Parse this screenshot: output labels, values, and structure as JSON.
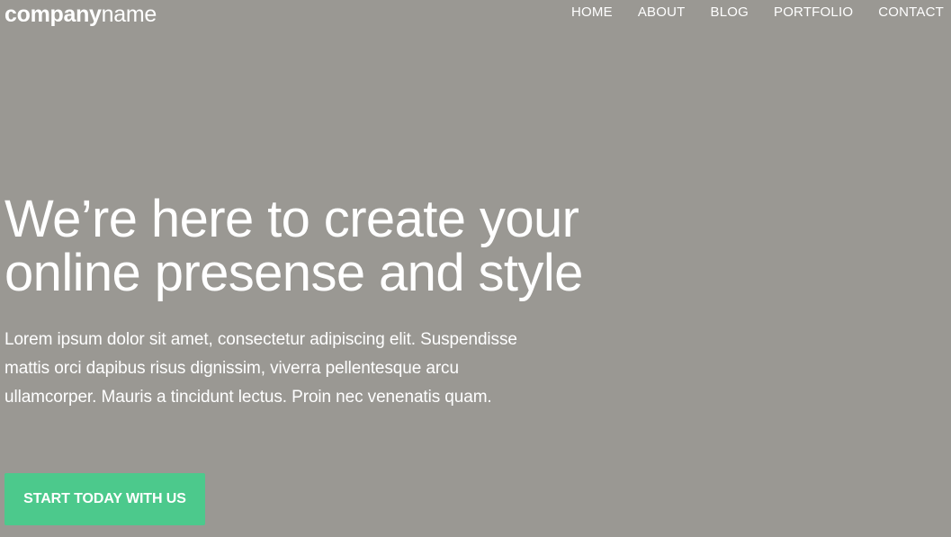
{
  "header": {
    "logo_strong": "company",
    "logo_light": "name",
    "nav": [
      "HOME",
      "ABOUT",
      "BLOG",
      "PORTFOLIO",
      "CONTACT"
    ]
  },
  "hero": {
    "title_line_1": "We’re here to create your",
    "title_line_2": "online presense and style",
    "body_line_1": "Lorem ipsum dolor sit amet, consectetur adipiscing elit. Suspendisse",
    "body_line_2": "mattis orci dapibus risus dignissim, viverra pellentesque arcu",
    "body_line_3": "ullamcorper. Mauris a tincidunt lectus. Proin nec venenatis quam.",
    "cta_label": "START TODAY WITH US"
  },
  "colors": {
    "background": "#9a9893",
    "text": "#ffffff",
    "accent": "#4cc98c"
  }
}
